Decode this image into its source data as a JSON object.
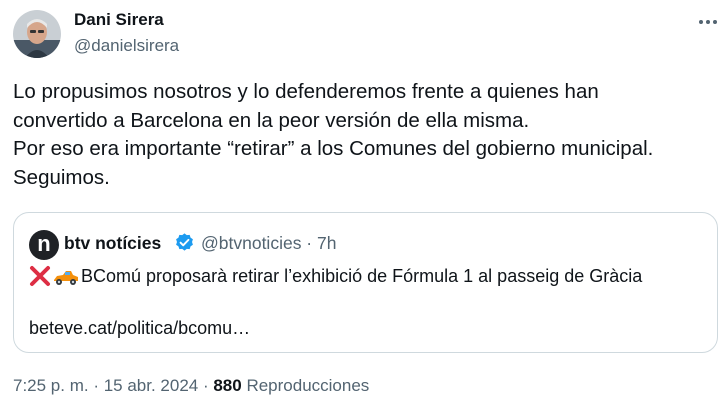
{
  "author": {
    "name": "Dani Sirera",
    "handle": "@danielsirera"
  },
  "tweet": {
    "lines": [
      "Lo propusimos nosotros y lo defenderemos frente a quienes han",
      "convertido a Barcelona en la peor versión de ella misma.",
      "Por eso era importante “retirar” a los Comunes del gobierno municipal.",
      "Seguimos."
    ]
  },
  "quote": {
    "avatar_letter": "n",
    "name": "btv notícies",
    "handle": "@btvnoticies · 7h",
    "text": "BComú proposarà retirar l’exhibició de Fórmula 1 al passeig de Gràcia",
    "link": "beteve.cat/politica/bcomu…",
    "emojis": [
      "cross-mark-icon",
      "racing-car-icon"
    ]
  },
  "meta": {
    "timestamp": "7:25 p. m. · 15 abr. 2024 · ",
    "views_count": "880",
    "views_label": " Reproducciones"
  },
  "colors": {
    "text": "#0f1419",
    "secondary": "#536471",
    "border": "#cfd9de",
    "verified": "#1d9bf0"
  }
}
